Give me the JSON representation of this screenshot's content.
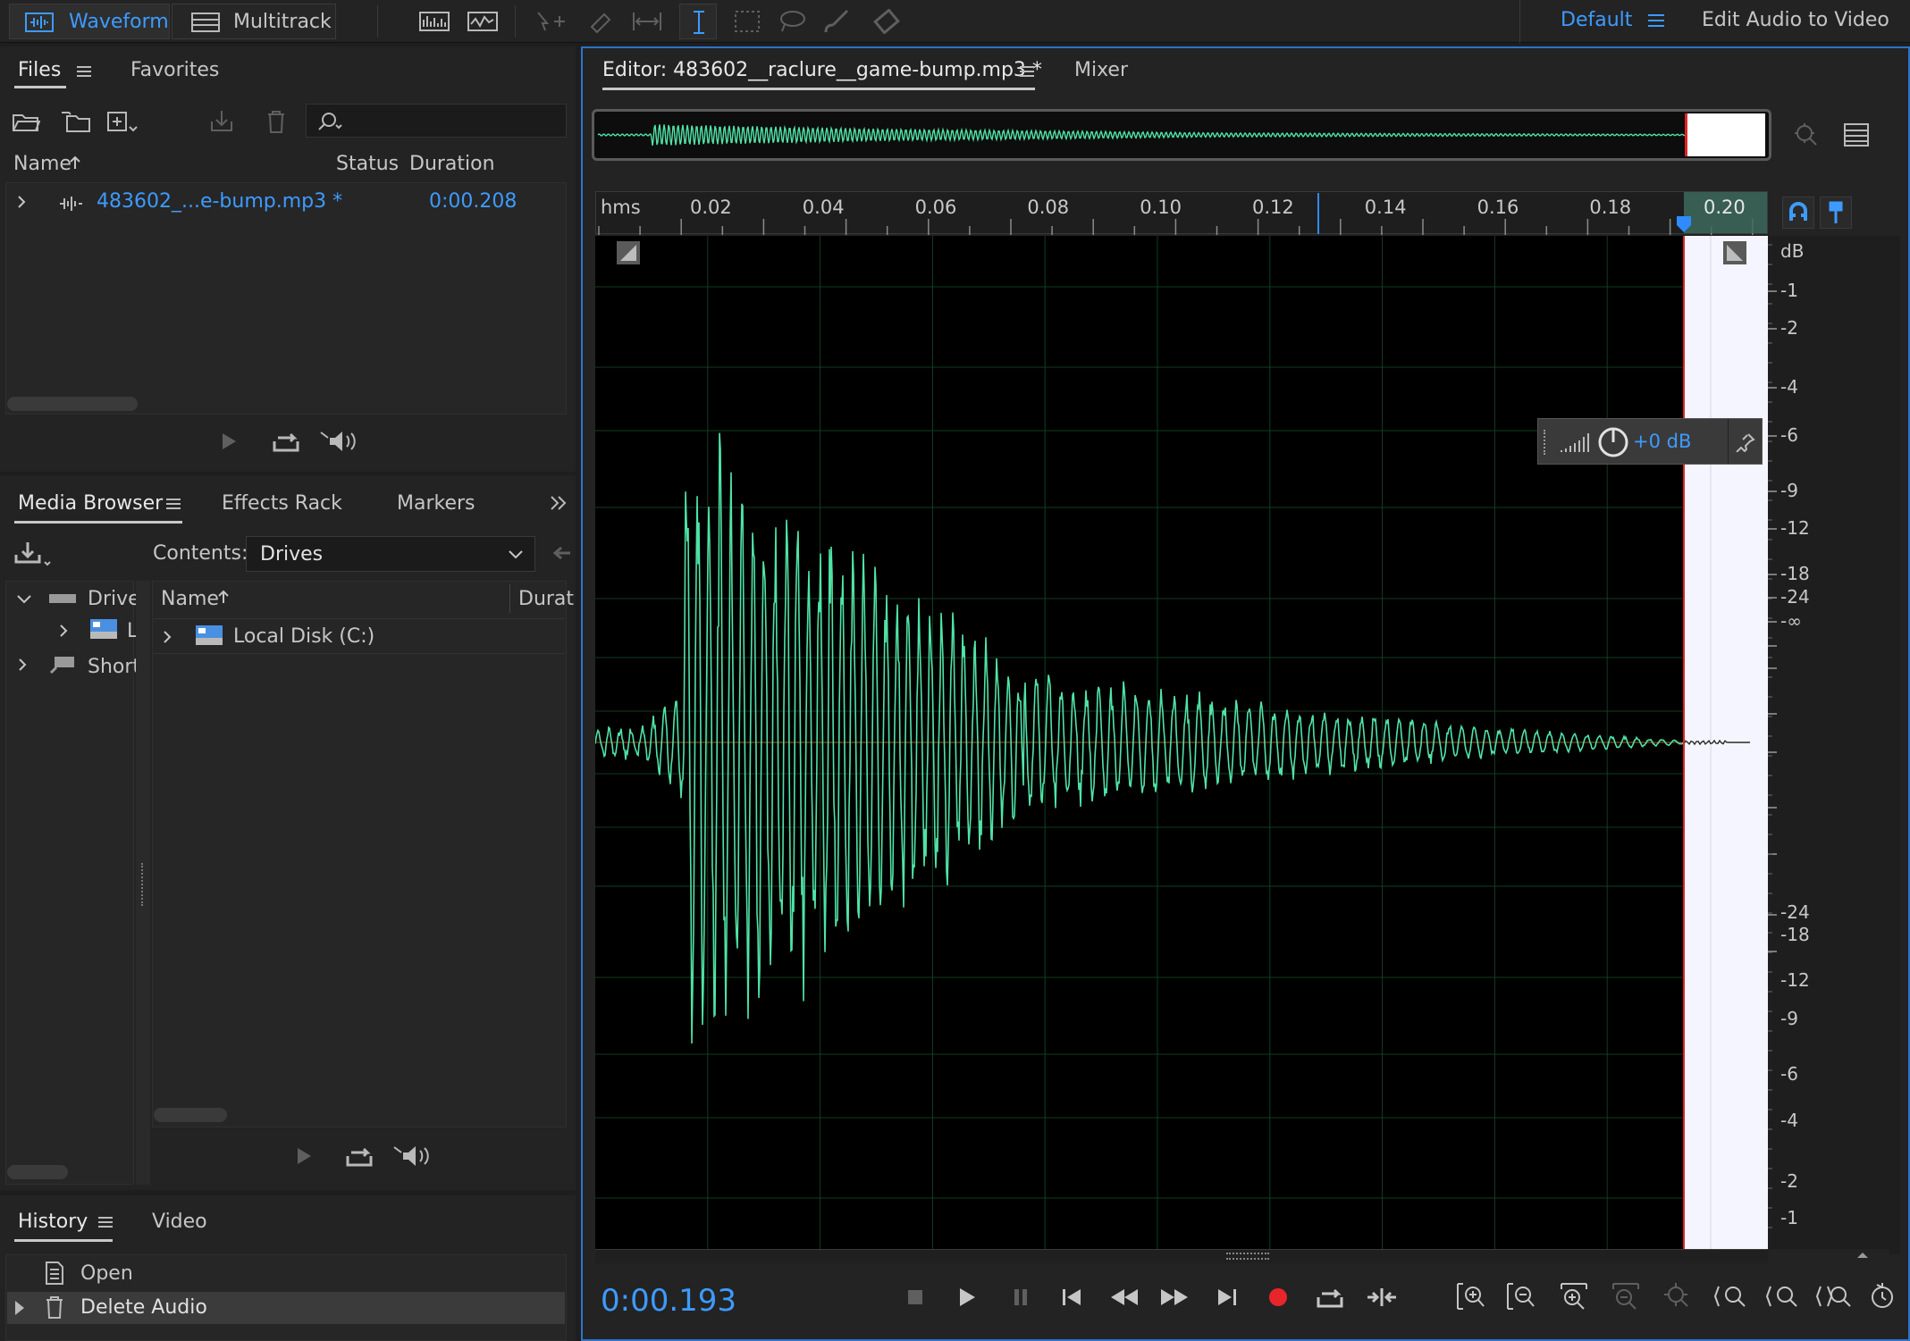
{
  "toolbar": {
    "waveform_label": "Waveform",
    "multitrack_label": "Multitrack",
    "workspace_label": "Default",
    "edit_audio_video_label": "Edit Audio to Video"
  },
  "files_panel": {
    "tab_files": "Files",
    "tab_favorites": "Favorites",
    "col_name": "Name",
    "col_status": "Status",
    "col_duration": "Duration",
    "file_name": "483602_...e-bump.mp3 *",
    "file_duration": "0:00.208"
  },
  "media_panel": {
    "tab_media_browser": "Media Browser",
    "tab_effects_rack": "Effects Rack",
    "tab_markers": "Markers",
    "contents_label": "Contents:",
    "contents_value": "Drives",
    "tree_drives": "Drive",
    "tree_local": "L",
    "tree_shortcuts": "Short",
    "col_name": "Name",
    "col_duration": "Durat",
    "local_disk": "Local Disk (C:)"
  },
  "history_panel": {
    "tab_history": "History",
    "tab_video": "Video",
    "items": [
      "Open",
      "Delete Audio"
    ]
  },
  "editor": {
    "tab_editor": "Editor: 483602__raclure__game-bump.mp3 *",
    "tab_mixer": "Mixer",
    "ruler_unit": "hms",
    "ruler_ticks": [
      "0.02",
      "0.04",
      "0.06",
      "0.08",
      "0.10",
      "0.12",
      "0.14",
      "0.16",
      "0.18",
      "0.20"
    ],
    "db_unit": "dB",
    "db_labels_top": [
      "-1",
      "-2",
      "-4",
      "-6",
      "-9",
      "-12",
      "-18",
      "-24",
      "-∞"
    ],
    "db_labels_bottom": [
      "-24",
      "-18",
      "-12",
      "-9",
      "-6",
      "-4",
      "-2",
      "-1"
    ],
    "hud_gain": "+0 dB",
    "time_display": "0:00.193"
  },
  "colors": {
    "accent_blue": "#2f8bff",
    "waveform_green": "#4fe3a6",
    "playhead_red": "#e02424",
    "record_red": "#e8252b"
  }
}
